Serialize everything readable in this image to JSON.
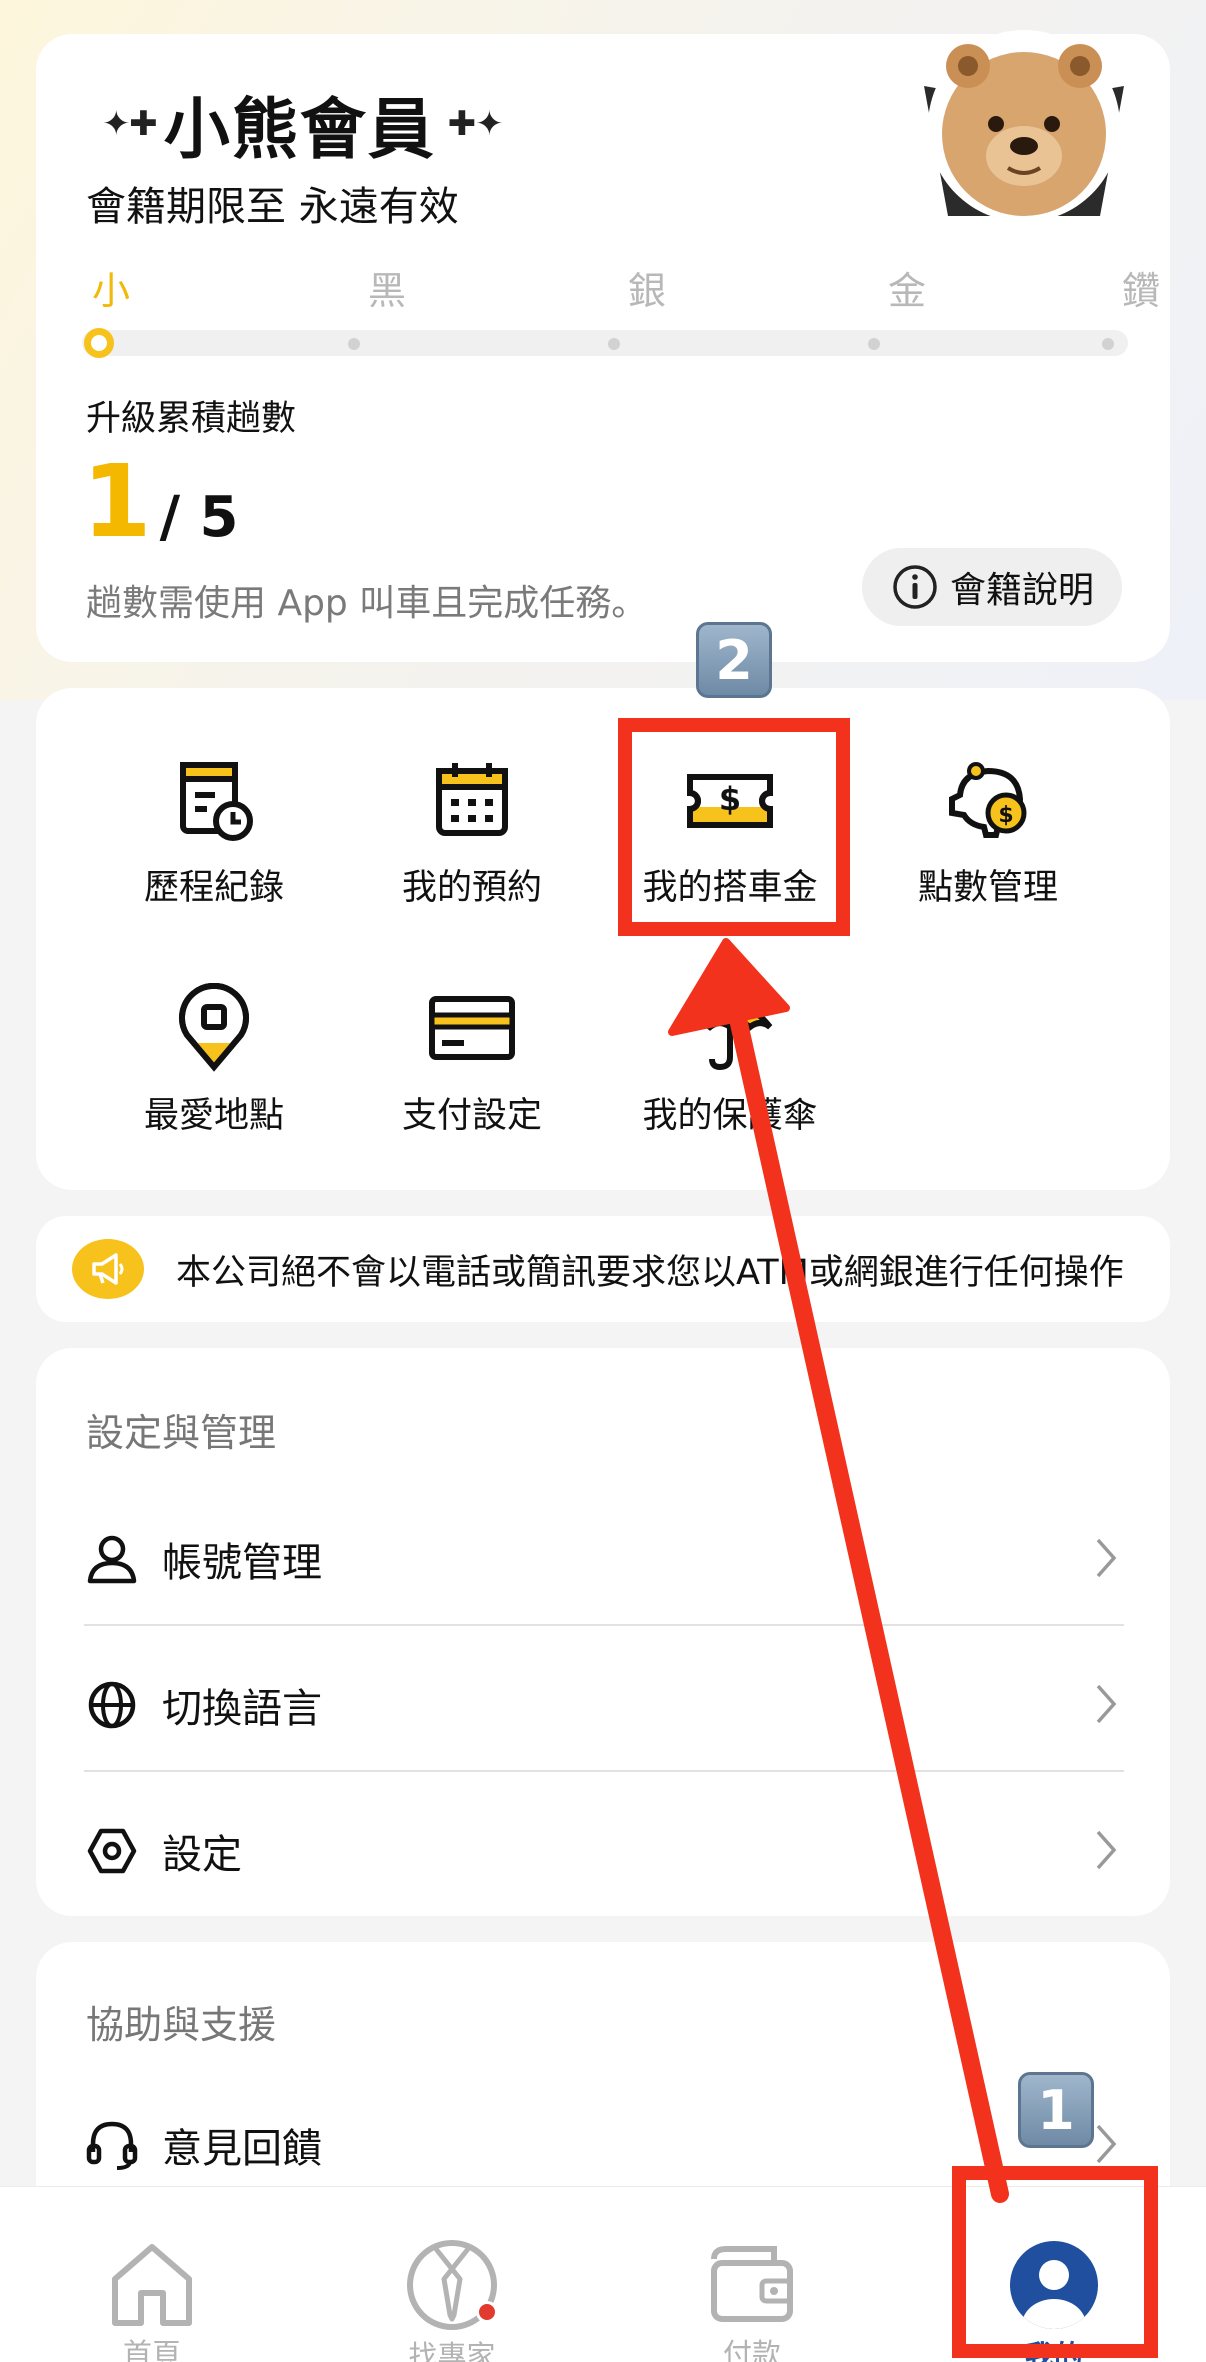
{
  "member": {
    "title": "小熊會員",
    "expiry": "會籍期限至 永遠有效",
    "tiers": [
      "小",
      "黑",
      "銀",
      "金",
      "鑽"
    ],
    "current_tier_index": 0,
    "upgrade_label": "升級累積趟數",
    "trips_current": "1",
    "trips_total": "/ 5",
    "note": "趟數需使用 App 叫車且完成任務。",
    "info_button": "會籍說明"
  },
  "services": [
    {
      "label": "歷程紀錄",
      "icon": "history-receipt-icon"
    },
    {
      "label": "我的預約",
      "icon": "calendar-icon"
    },
    {
      "label": "我的搭車金",
      "icon": "ride-credit-ticket-icon"
    },
    {
      "label": "點數管理",
      "icon": "piggy-bank-coin-icon"
    },
    {
      "label": "最愛地點",
      "icon": "favorite-location-pin-icon"
    },
    {
      "label": "支付設定",
      "icon": "credit-card-icon"
    },
    {
      "label": "我的保護傘",
      "icon": "umbrella-icon"
    }
  ],
  "notice": {
    "text": "本公司絕不會以電話或簡訊要求您以ATM或網銀進行任何操作",
    "icon": "megaphone-icon"
  },
  "settings": {
    "title": "設定與管理",
    "items": [
      {
        "label": "帳號管理",
        "icon": "person-icon"
      },
      {
        "label": "切換語言",
        "icon": "globe-icon"
      },
      {
        "label": "設定",
        "icon": "hexagon-nut-icon"
      }
    ]
  },
  "support": {
    "title": "協助與支援",
    "items": [
      {
        "label": "意見回饋",
        "icon": "headset-icon"
      }
    ]
  },
  "tabbar": {
    "tabs": [
      {
        "label": "首頁",
        "icon": "home-icon",
        "active": false
      },
      {
        "label": "找專家",
        "icon": "expert-tie-icon",
        "active": false,
        "badge_dot": true
      },
      {
        "label": "付款",
        "icon": "wallet-icon",
        "active": false
      },
      {
        "label": "我的",
        "icon": "profile-icon",
        "active": true
      }
    ]
  },
  "annotations": {
    "step1": "1",
    "step2": "2",
    "color": "#f2321c"
  },
  "colors": {
    "accent": "#f7c21b",
    "active_tab": "#1f4f9e",
    "background": "#f4f4f5"
  }
}
